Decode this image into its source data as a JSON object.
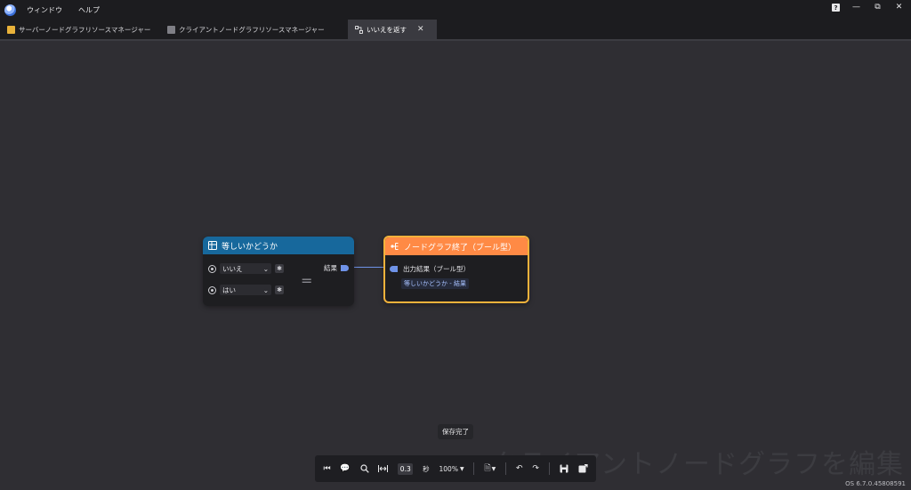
{
  "menu": {
    "items": [
      "ウィンドウ",
      "ヘルプ"
    ]
  },
  "window_controls": {
    "help_label": "?"
  },
  "tabs": [
    {
      "label": "サーバーノードグラフリソースマネージャー",
      "icon": "resource-manager-icon",
      "color": "#e9b23a"
    },
    {
      "label": "クライアントノードグラフリソースマネージャー",
      "icon": "resource-manager-icon",
      "color": "#7f7f86"
    },
    {
      "label": "いいえを返す",
      "icon": "node-graph-icon",
      "active": true
    }
  ],
  "node_equal": {
    "title": "等しいかどうか",
    "inputs": [
      {
        "value": "いいえ"
      },
      {
        "value": "はい"
      }
    ],
    "output_label": "結果",
    "operator": "=",
    "header_color": "#17689c"
  },
  "node_end": {
    "title": "ノードグラフ終了（ブール型）",
    "input_label": "出力結果（ブール型）",
    "connection_tag": "等しいかどうか - 結果",
    "header_color": "#ff8a45",
    "border_color": "#f2b23b"
  },
  "toast": {
    "text": "保存完了"
  },
  "toolbar": {
    "interval_value": "0.3",
    "interval_unit": "秒",
    "zoom": "100%"
  },
  "watermark": "クライアントノードグラフを編集",
  "version": "OS 6.7.0.45808591"
}
